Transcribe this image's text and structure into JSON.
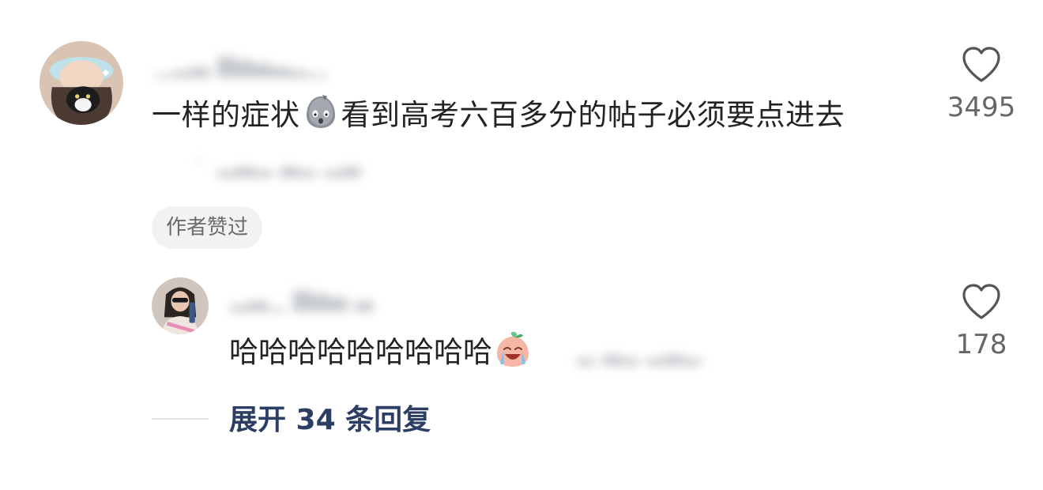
{
  "comment": {
    "avatar": "user-avatar-cat-photo",
    "text_before_emoji": "一样的症状",
    "emoji": "blob-shocked-emoji",
    "text_after_emoji": "看到高考六百多分的帖子必须要点进去",
    "author_badge": "作者赞过",
    "like_icon": "heart-icon",
    "like_count": "3495"
  },
  "reply": {
    "avatar": "user-avatar-photo",
    "text": "哈哈哈哈哈哈哈哈哈",
    "emoji": "crying-laughing-peach-emoji",
    "like_icon": "heart-icon",
    "like_count": "178"
  },
  "expand": {
    "label": "展开 34 条回复"
  },
  "colors": {
    "link": "#2c3e63",
    "muted": "#666666",
    "badge_bg": "#f2f2f2"
  }
}
